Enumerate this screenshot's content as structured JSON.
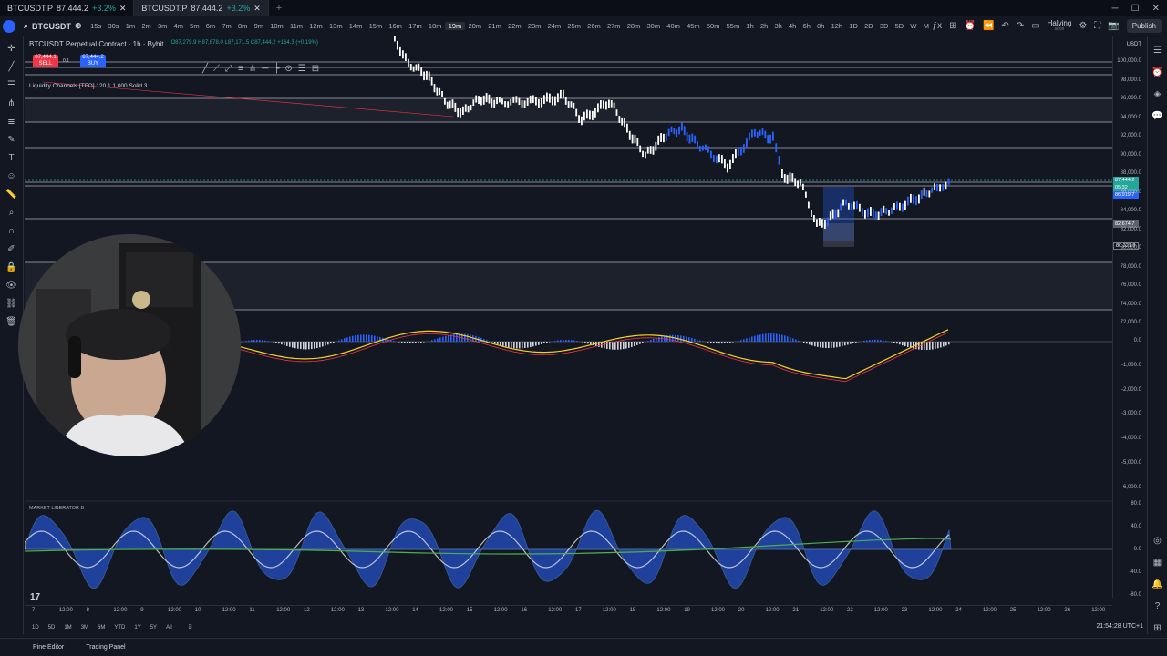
{
  "tabs": [
    {
      "symbol": "BTCUSDT.P",
      "price": "87,444.2",
      "change": "+3.2%"
    },
    {
      "symbol": "BTCUSDT.P",
      "price": "87,444.2",
      "change": "+3.2%"
    }
  ],
  "tab_add": "+",
  "toolbar": {
    "symbol": "BTCUSDT",
    "intervals": [
      "15s",
      "30s",
      "1m",
      "2m",
      "3m",
      "4m",
      "5m",
      "6m",
      "7m",
      "8m",
      "9m",
      "10m",
      "11m",
      "12m",
      "13m",
      "14m",
      "15m",
      "16m",
      "17m",
      "18m",
      "19m",
      "20m",
      "21m",
      "22m",
      "23m",
      "24m",
      "25m",
      "26m",
      "27m",
      "28m",
      "30m",
      "40m",
      "45m",
      "50m",
      "55m",
      "1h",
      "2h",
      "3h",
      "4h",
      "6h",
      "8h",
      "12h",
      "1D",
      "2D",
      "3D",
      "5D",
      "W",
      "M"
    ],
    "active_interval": "19m",
    "halving_line1": "Halving",
    "halving_line2": "soon",
    "publish": "Publish"
  },
  "legend": {
    "title": "BTCUSDT Perpetual Contract · 1h · Bybit",
    "ohlc": "O87,279.9 H87,678.0 L87,171.5 C87,444.2 +164.3 (+0.19%)",
    "sell_price": "87,444.1",
    "sell_label": "SELL",
    "buy_price": "87,444.2",
    "buy_label": "BUY",
    "spread": "0.1",
    "indicator": "Liquidity Channels [TFO] 120 1 1,000 Solid 3",
    "oscillator_label": "MARKET LIBERATOR B"
  },
  "price_axis": {
    "currency": "USDT",
    "labels": [
      "100,000.0",
      "98,000.0",
      "96,000.0",
      "94,000.0",
      "92,000.0",
      "90,000.0",
      "88,000.0",
      "86,000.0",
      "84,000.0",
      "82,000.0",
      "80,000.0",
      "78,000.0",
      "76,000.0",
      "74,000.0",
      "72,000.0"
    ],
    "tags": {
      "last": "87,444.2",
      "countdown": "05:32",
      "level_blue": "86,919.7",
      "level_gray": "82,674.7",
      "level_low": "80,321.8"
    },
    "macd_labels": [
      "0.0",
      "-1,000.0",
      "-2,000.0",
      "-3,000.0",
      "-4,000.0",
      "-5,000.0",
      "-6,000.0"
    ],
    "osc_labels": [
      "80.0",
      "40.0",
      "0.0",
      "-40.0",
      "-80.0"
    ]
  },
  "time_axis": [
    "7",
    "12:00",
    "8",
    "12:00",
    "9",
    "12:00",
    "10",
    "12:00",
    "11",
    "12:00",
    "12",
    "12:00",
    "13",
    "12:00",
    "14",
    "12:00",
    "15",
    "12:00",
    "16",
    "12:00",
    "17",
    "12:00",
    "18",
    "12:00",
    "19",
    "12:00",
    "20",
    "12:00",
    "21",
    "12:00",
    "22",
    "12:00",
    "23",
    "12:00",
    "24",
    "12:00",
    "25",
    "12:00",
    "26",
    "12:00"
  ],
  "ranges": [
    "1D",
    "5D",
    "1M",
    "3M",
    "6M",
    "YTD",
    "1Y",
    "5Y",
    "All"
  ],
  "clock": "21:54:28 UTC+1",
  "bottom_tabs": [
    "Pine Editor",
    "Trading Panel"
  ],
  "tv_logo": "17",
  "colors": {
    "bg": "#131722",
    "up": "#26a69a",
    "down": "#f23645",
    "blue": "#2962ff",
    "candle": "#ffffff",
    "macd": "#f5d327"
  }
}
